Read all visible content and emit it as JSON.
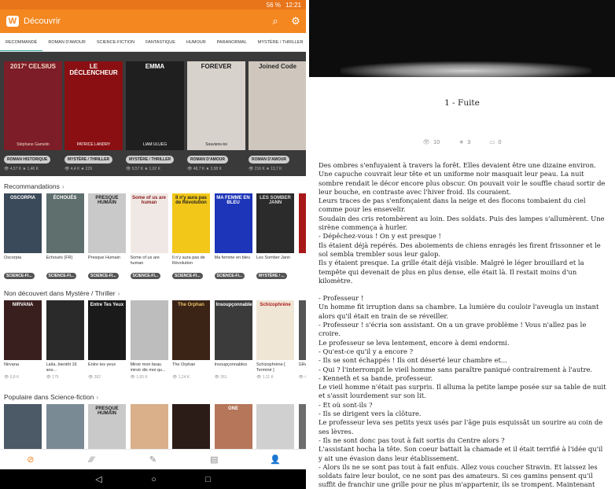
{
  "status_bar": {
    "battery": "56 %",
    "time": "12:21"
  },
  "app_bar": {
    "logo_letter": "W",
    "title": "Découvrir",
    "search_icon": "search-icon",
    "settings_icon": "gear-icon"
  },
  "tabs": [
    "RECOMMANDÉ",
    "ROMAN D'AMOUR",
    "SCIENCE-FICTION",
    "FANTASTIQUE",
    "HUMOUR",
    "PARANORMAL",
    "MYSTÈRE / THRILLER"
  ],
  "featured": [
    {
      "title": "2017° CELSIUS",
      "author": "Stéphane Gamelin",
      "tag": "ROMAN HISTORIQUE",
      "stats": "👁 4,57 K   ★ 1,46 K",
      "bg": "#7d1d28",
      "fg": "#f3d9c4"
    },
    {
      "title": "LE DÉCLENCHEUR",
      "author": "PATRICE LANDRY",
      "tag": "MYSTÈRE / THRILLER",
      "stats": "👁 4,4 K   ★ 229",
      "bg": "#8a0f12",
      "fg": "#ffffff"
    },
    {
      "title": "EMMA",
      "author": "LIAM ULUEG",
      "tag": "MYSTÈRE / THRILLER",
      "stats": "👁 9,57 K   ★ 1,02 K",
      "bg": "#1f1f1f",
      "fg": "#ffffff"
    },
    {
      "title": "FOREVER",
      "author": "Souviens-toi",
      "tag": "ROMAN D'AMOUR",
      "stats": "👁 48,7 K   ★ 3,58 K",
      "bg": "#d8d2cc",
      "fg": "#1a1a1a"
    },
    {
      "title": "Joined Code",
      "author": "",
      "tag": "ROMAN D'AMOUR",
      "stats": "👁 216 K   ★ 13,7 K",
      "bg": "#cfc7bd",
      "fg": "#2a2a2a"
    }
  ],
  "sections": [
    {
      "title": "Recommandations",
      "books": [
        {
          "cover": "OSCORPIA",
          "title": "Oscorpia",
          "tag": "SCIENCE-FI...",
          "bg": "#3b4a5a",
          "fg": "#ffffff"
        },
        {
          "cover": "ÉCHOUÉS",
          "title": "Échoués (FR)",
          "tag": "SCIENCE-FI...",
          "bg": "#5f6f6d",
          "fg": "#ffffff"
        },
        {
          "cover": "PRESQUE HUMAIN",
          "title": "Presque Humain",
          "tag": "SCIENCE-FI...",
          "bg": "#c9c9c9",
          "fg": "#222222"
        },
        {
          "cover": "Some of us are human",
          "title": "Some of us are human",
          "tag": "SCIENCE-FI...",
          "bg": "#f0e8e4",
          "fg": "#8a1c1c"
        },
        {
          "cover": "Il n'y aura pas de Révolution",
          "title": "Il n'y aura pas de Révolution",
          "tag": "SCIENCE-FI...",
          "bg": "#f2c71a",
          "fg": "#222222"
        },
        {
          "cover": "MA FEMME EN BLEU",
          "title": "Ma femme en bleu",
          "tag": "SCIENCE-FI...",
          "bg": "#1d35b8",
          "fg": "#ffffff"
        },
        {
          "cover": "LES SOMBER JANN",
          "title": "Les Somber Jann",
          "tag": "MYSTÈRE / ...",
          "bg": "#2b2b2b",
          "fg": "#dddddd"
        },
        {
          "cover": "",
          "title": "",
          "tag": "",
          "bg": "#a81818",
          "fg": "#ffffff"
        }
      ]
    },
    {
      "title": "Non découvert dans Mystère / Thriller",
      "books": [
        {
          "cover": "NIRVANA",
          "title": "Nirvana",
          "stat": "👁 6,8 K",
          "bg": "#3a1f1f",
          "fg": "#ffffff"
        },
        {
          "cover": "",
          "title": "Laïla, bientôt 16 ans...",
          "stat": "👁 175",
          "bg": "#2a2a2a",
          "fg": "#ffffff"
        },
        {
          "cover": "Entre Tes Yeux",
          "title": "Entre tes yeux",
          "stat": "👁 262",
          "bg": "#1a1a1a",
          "fg": "#ffffff"
        },
        {
          "cover": "",
          "title": "Miroir mon beau miroir dis moi qu...",
          "stat": "👁 1,65 K",
          "bg": "#bdbdbd",
          "fg": "#222222"
        },
        {
          "cover": "The Orphan",
          "title": "The Orphan",
          "stat": "👁 1,24 K",
          "bg": "#3b2416",
          "fg": "#e9c36a"
        },
        {
          "cover": "Insoupçonnables",
          "title": "Insoupçonnables",
          "stat": "👁 261",
          "bg": "#3b3b3b",
          "fg": "#ffffff"
        },
        {
          "cover": "Schizophrène",
          "title": "Schizophrène [ Terminé ]",
          "stat": "👁 1,11 K",
          "bg": "#efe6d6",
          "fg": "#b01b1b"
        },
        {
          "cover": "",
          "title": "GRÂ",
          "stat": "👁 4",
          "bg": "#555555",
          "fg": "#ffffff"
        }
      ]
    },
    {
      "title": "Populaire dans Science-fiction",
      "books": [
        {
          "cover": "",
          "title": "",
          "bg": "#4c5966",
          "fg": "#ffffff"
        },
        {
          "cover": "",
          "title": "",
          "bg": "#7a8a95",
          "fg": "#ffffff"
        },
        {
          "cover": "PRESQUE HUMAIN",
          "title": "",
          "bg": "#c9c9c9",
          "fg": "#222222"
        },
        {
          "cover": "",
          "title": "",
          "bg": "#d9b08a",
          "fg": "#ffffff"
        },
        {
          "cover": "",
          "title": "",
          "bg": "#2b1c18",
          "fg": "#ffffff"
        },
        {
          "cover": "ONE",
          "title": "",
          "bg": "#b5765a",
          "fg": "#ffffff"
        },
        {
          "cover": "",
          "title": "",
          "bg": "#d0d0d0",
          "fg": "#222222"
        },
        {
          "cover": "",
          "title": "",
          "bg": "#6d6d6d",
          "fg": "#ffffff"
        }
      ]
    }
  ],
  "bottom_nav": [
    {
      "icon": "compass-icon",
      "glyph": "⊘",
      "active": true
    },
    {
      "icon": "library-icon",
      "glyph": "⁄⁄⁄",
      "active": false
    },
    {
      "icon": "write-icon",
      "glyph": "✎",
      "active": false
    },
    {
      "icon": "messages-icon",
      "glyph": "▤",
      "active": false
    },
    {
      "icon": "profile-icon",
      "glyph": "👤",
      "active": false
    }
  ],
  "android_nav": [
    "◁",
    "○",
    "□"
  ],
  "reader": {
    "chapter_title": "1 - Fuite",
    "views": "10",
    "votes": "3",
    "comments": "0",
    "paragraphs": [
      "Des ombres s'enfuyaient à travers la forêt. Elles devaient être une dizaine environ. Une capuche couvrait leur tête et un uniforme noir masquait leur peau. La nuit sombre rendait le décor encore plus obscur. On pouvait voir le souffle chaud sortir de leur bouche, en contraste avec l'hiver froid. Ils couraient.",
      "Leurs traces de pas s'enfonçaient dans la neige et des flocons tombaient du ciel comme pour les ensevelir.",
      "Soudain des cris retombèrent au loin. Des soldats. Puis des lampes s'allumèrent. Une sirène commença à hurler.",
      "- Dépêchez-vous ! On y est presque !",
      "Ils étaient déjà repérés. Des aboiements de chiens enragés les firent frissonner et le sol sembla trembler sous leur galop.",
      "Ils y étaient presque. La grille était déjà visible. Malgré le léger brouillard et la tempête qui devenait de plus en plus dense, elle était là. Il restait moins d'un kilomètre.",
      "",
      "- Professeur !",
      "Un homme fit irruption dans sa chambre. La lumière du couloir l'aveugla un instant alors qu'il était en train de se réveiller.",
      "- Professeur ! s'écria son assistant. On a un grave problème ! Vous n'allez pas le croire.",
      "Le professeur se leva lentement, encore à demi endormi.",
      "- Qu'est-ce qu'il y a encore ?",
      "- Ils se sont échappés ! Ils ont déserté leur chambre et...",
      "- Qui ? l'interrompit le vieil homme sans paraître paniqué contrairement à l'autre.",
      "- Kenneth et sa bande, professeur.",
      "Le vieil homme n'était pas surpris. Il alluma la petite lampe posée sur sa table de nuit et s'assit lourdement sur son lit.",
      "- Et où sont-ils ?",
      "- Ils se dirigent vers la clôture.",
      "Le professeur leva ses petits yeux usés par l'âge puis esquissât un sourire au coin de ses lèvres.",
      "- Ils ne sont donc pas tout à fait sortis du Centre alors ?",
      "L'assistant hocha la tête. Son coeur battait la chamade et il était terrifié à l'idée qu'il y ait une évasion dans leur établissement.",
      "- Alors ils ne se sont pas tout à fait enfuis. Allez vous coucher Stravin. Et laissez les soldats faire leur boulot, ce ne sont pas des amateurs. Si ces gamins pensent qu'il suffit de franchir une grille pour ne plus m'appartenir, ils se trompent. Maintenant laissez moi dormir, j'éclaircirais cette affaire demain."
    ]
  }
}
